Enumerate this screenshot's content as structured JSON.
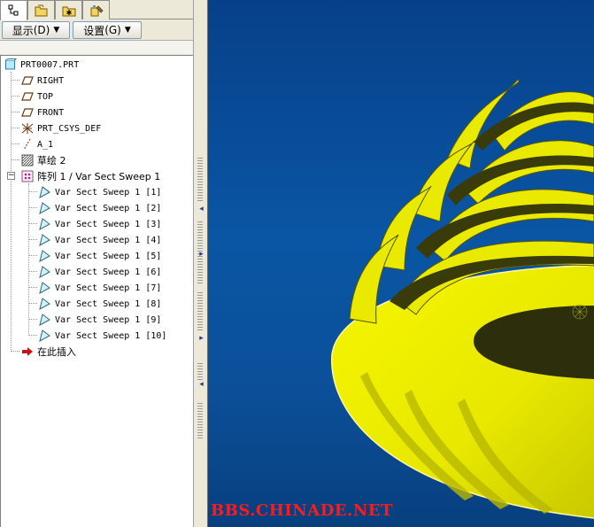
{
  "toolbar": {
    "tabs": [
      {
        "icon": "model-tree-icon",
        "active": true
      },
      {
        "icon": "folder-browser-icon",
        "active": false
      },
      {
        "icon": "favorites-icon",
        "active": false
      },
      {
        "icon": "connections-icon",
        "active": false
      }
    ],
    "show_label": "显示",
    "show_key": "(D)",
    "settings_label": "设置",
    "settings_key": "(G)"
  },
  "tree": {
    "root": "PRT0007.PRT",
    "items": [
      {
        "label": "RIGHT",
        "icon": "datum-plane-icon"
      },
      {
        "label": "TOP",
        "icon": "datum-plane-icon"
      },
      {
        "label": "FRONT",
        "icon": "datum-plane-icon"
      },
      {
        "label": "PRT_CSYS_DEF",
        "icon": "coordinate-system-icon"
      },
      {
        "label": "A_1",
        "icon": "datum-axis-icon"
      },
      {
        "label": "草绘 2",
        "icon": "sketch-icon"
      }
    ],
    "pattern": {
      "label": "阵列 1 / Var Sect Sweep 1",
      "expander": "−",
      "children": [
        "Var Sect Sweep 1 [1]",
        "Var Sect Sweep 1 [2]",
        "Var Sect Sweep 1 [3]",
        "Var Sect Sweep 1 [4]",
        "Var Sect Sweep 1 [5]",
        "Var Sect Sweep 1 [6]",
        "Var Sect Sweep 1 [7]",
        "Var Sect Sweep 1 [8]",
        "Var Sect Sweep 1 [9]",
        "Var Sect Sweep 1 [10]"
      ]
    },
    "insert_here": "在此插入"
  },
  "watermark": "BBS.CHINADE.NET",
  "colors": {
    "model_yellow": "#f2f200",
    "model_shadow": "#4a4a06",
    "background_blue": "#0a56a4",
    "insert_arrow": "#d01010",
    "watermark": "#ff1a1a"
  }
}
